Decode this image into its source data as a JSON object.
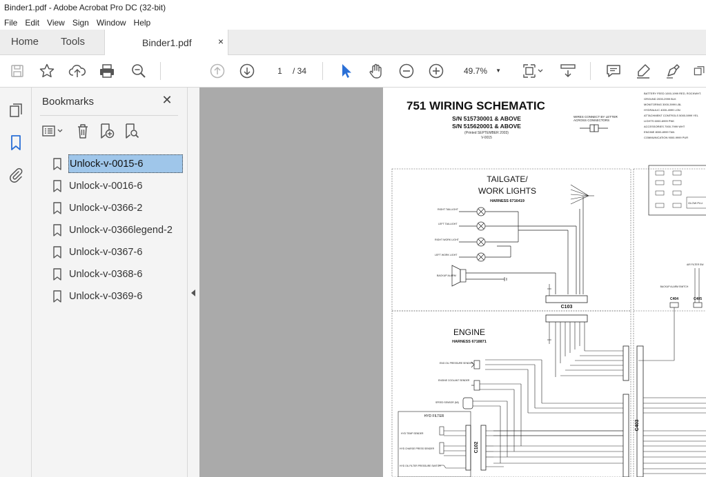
{
  "window": {
    "title": "Binder1.pdf - Adobe Acrobat Pro DC (32-bit)"
  },
  "menu": {
    "items": [
      "File",
      "Edit",
      "View",
      "Sign",
      "Window",
      "Help"
    ]
  },
  "tabs": {
    "home": "Home",
    "tools": "Tools",
    "document": "Binder1.pdf",
    "close": "×"
  },
  "toolbar": {
    "page_current": "1",
    "page_total": "/  34",
    "zoom": "49.7%"
  },
  "panel": {
    "title": "Bookmarks",
    "items": [
      {
        "label": "Unlock-v-0015-6",
        "selected": true
      },
      {
        "label": "Unlock-v-0016-6"
      },
      {
        "label": "Unlock-v-0366-2"
      },
      {
        "label": "Unlock-v-0366legend-2"
      },
      {
        "label": "Unlock-v-0367-6"
      },
      {
        "label": "Unlock-v-0368-6"
      },
      {
        "label": "Unlock-v-0369-6"
      }
    ]
  },
  "schematic": {
    "title": "751 WIRING SCHEMATIC",
    "sn1": "S/N 515730001 & ABOVE",
    "sn2": "S/N 515620001 & ABOVE",
    "printed": "(Printed SEPTEMBER 2003)",
    "code": "V-0015",
    "wires_note_1": "WIRES CONNECT BY LETTER",
    "wires_note_2": "ACROSS CONNECTORS",
    "legend": [
      "BATTERY FEED 1000-1999 RED, ROCKWHT.",
      "GROUND 2000-2999 BLK",
      "MONITORING 3000-3999 LBL",
      "HYDRAULIC 4000-4999 LGN",
      "ATTACHMENT CONTROLS 5000-5999 YEL",
      "LIGHTS 6000-6999 PNK",
      "ACCESSORIES 7000-7999 WHT",
      "ENGINE 8000-8999 TAN",
      "COMMUNICATION 9000-9999 PUR"
    ],
    "tailgate_title_1": "TAILGATE/",
    "tailgate_title_2": "WORK LIGHTS",
    "tailgate_harness": "HARNESS 6716419",
    "engine_title": "ENGINE",
    "engine_harness": "HARNESS 6718871",
    "c103": "C103",
    "c102": "C102",
    "c403": "C403",
    "c404": "C404",
    "c405": "C405",
    "lights": [
      "RIGHT TAILLIGHT",
      "LEFT TAILLIGHT",
      "RIGHT WORK LIGHT",
      "LEFT WORK LIGHT"
    ],
    "backup_alarm": "BACKUP ALARM",
    "backup_switch": "BACKUP ALARM SWITCH",
    "eng_oil": "ENG OIL PRESSURE SENDER",
    "eng_coolant": "ENGINE COOLANT SENDER",
    "speed_sensor": "SPEED SENSOR (MI)",
    "hyd_filter": "HYD FILTER",
    "hyd_temp": "HYD TEMP SENDER",
    "hyd_charge": "HYD CHARGE PRESS SENDER",
    "hyd_oil_filter": "HYD OIL FILTER PRESSURE SWITCH",
    "glow_plug": "GLOW PLU",
    "air_filter": "AIR FILTER SW"
  }
}
